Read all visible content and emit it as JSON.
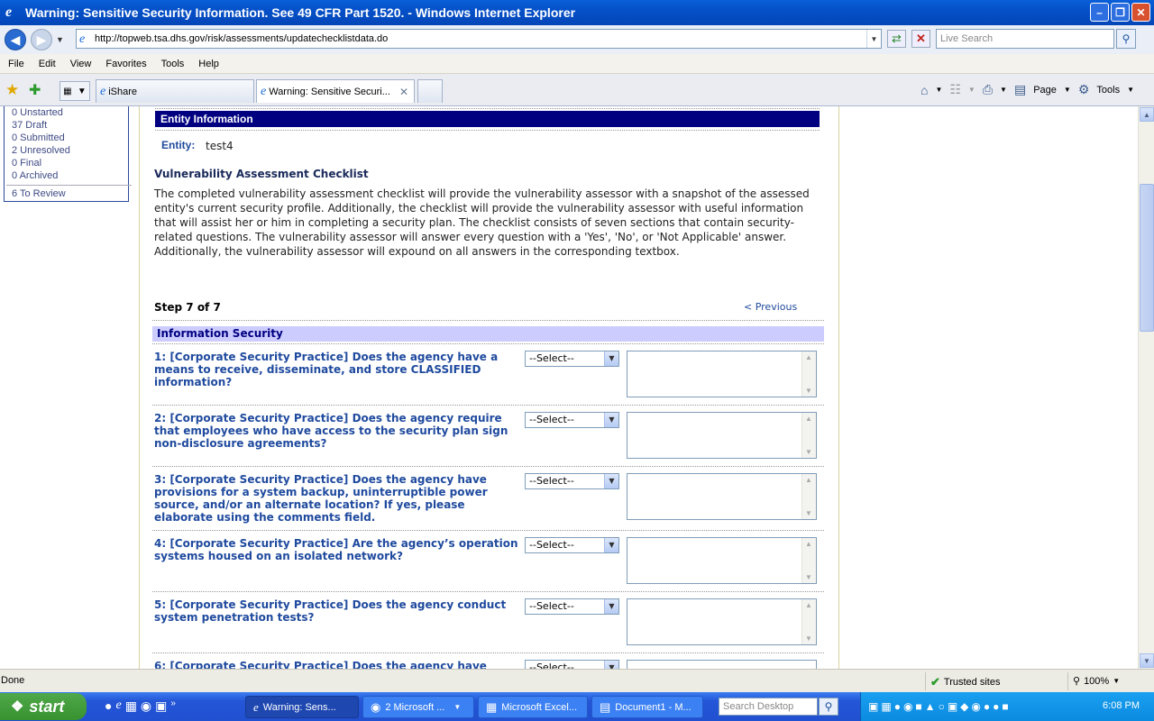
{
  "window": {
    "title": "Warning: Sensitive Security Information. See 49 CFR Part 1520. - Windows Internet Explorer"
  },
  "address": {
    "url": "http://topweb.tsa.dhs.gov/risk/assessments/updatechecklistdata.do",
    "search_placeholder": "Live Search"
  },
  "menu": [
    "File",
    "Edit",
    "View",
    "Favorites",
    "Tools",
    "Help"
  ],
  "tabs": [
    {
      "label": "iShare"
    },
    {
      "label": "Warning: Sensitive Securi..."
    }
  ],
  "toolbar": {
    "page_label": "Page",
    "tools_label": "Tools"
  },
  "sidebar": {
    "items": [
      "0 Unstarted",
      "37 Draft",
      "0 Submitted",
      "2 Unresolved",
      "0 Final",
      "0 Archived"
    ],
    "review": "6 To Review"
  },
  "entity": {
    "header": "Entity Information",
    "label": "Entity:",
    "value": "test4"
  },
  "checklist": {
    "title": "Vulnerability Assessment Checklist",
    "body": "The completed vulnerability assessment checklist will provide the vulnerability assessor with a snapshot of the assessed entity's current security profile. Additionally, the checklist will provide the vulnerability assessor with useful information that will assist her or him in completing a security plan. The checklist consists of seven sections that contain security-related questions. The vulnerability assessor will answer every question with a 'Yes', 'No', or 'Not Applicable' answer. Additionally, the vulnerability assessor will expound on all answers in the corresponding textbox.",
    "step": "Step 7 of 7",
    "previous": "< Previous",
    "section": "Information Security",
    "select_default": "--Select--",
    "questions": [
      "1: [Corporate Security Practice] Does the agency have a means to receive, disseminate, and store CLASSIFIED information?",
      "2: [Corporate Security Practice] Does the agency require that employees who have access to the security plan sign non-disclosure agreements?",
      "3: [Corporate Security Practice] Does the agency have provisions for a system backup, uninterruptible power source, and/or an alternate location? If yes, please elaborate using the comments field.",
      "4: [Corporate Security Practice] Are the agency’s operation systems housed on an isolated network?",
      "5: [Corporate Security Practice] Does the agency conduct system penetration tests?",
      "6: [Corporate Security Practice] Does the agency have"
    ]
  },
  "status": {
    "left": "Done",
    "zone": "Trusted sites",
    "zoom": "100%"
  },
  "taskbar": {
    "start": "start",
    "tasks": [
      "Warning: Sens...",
      "2 Microsoft ...",
      "Microsoft Excel...",
      "Document1 - M..."
    ],
    "search_placeholder": "Search Desktop",
    "clock": "6:08 PM"
  }
}
